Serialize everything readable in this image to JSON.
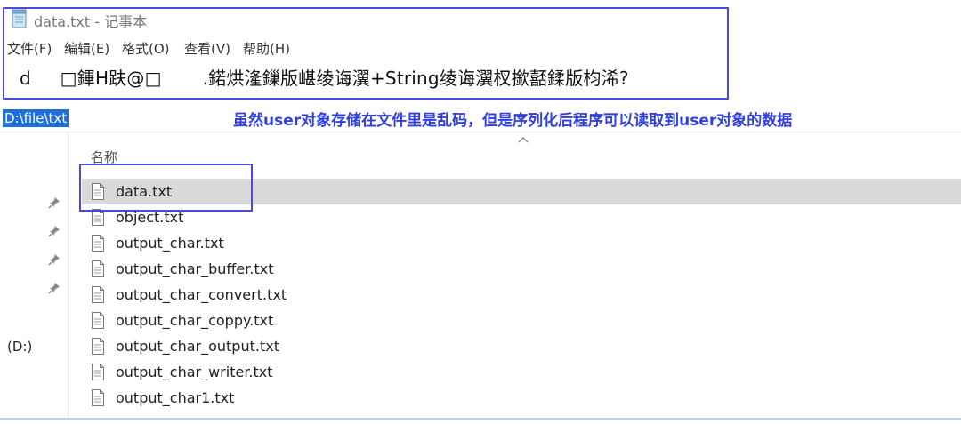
{
  "notepad": {
    "title": "data.txt - 记事本",
    "menu": [
      "文件(F)",
      "编辑(E)",
      "格式(O)",
      "查看(V)",
      "帮助(H)"
    ],
    "content": "d     □鏎H趺@□       .鍩烘湰鏁版嵁绫诲瀷+String绫诲瀷杈撳嚭鍒版枃浠?"
  },
  "explorer": {
    "address_path": "D:\\file\\txt",
    "annotation": "虽然user对象存储在文件里是乱码，但是序列化后程序可以读取到user对象的数据",
    "column_name": "名称",
    "drive_label": "(D:)",
    "files": [
      {
        "name": "data.txt",
        "selected": true
      },
      {
        "name": "object.txt",
        "selected": false
      },
      {
        "name": "output_char.txt",
        "selected": false
      },
      {
        "name": "output_char_buffer.txt",
        "selected": false
      },
      {
        "name": "output_char_convert.txt",
        "selected": false
      },
      {
        "name": "output_char_coppy.txt",
        "selected": false
      },
      {
        "name": "output_char_output.txt",
        "selected": false
      },
      {
        "name": "output_char_writer.txt",
        "selected": false
      },
      {
        "name": "output_char1.txt",
        "selected": false
      }
    ],
    "pinned_count": 4
  },
  "colors": {
    "highlight_box": "#4a4ad6",
    "annotation_text": "#2f3fe0",
    "selected_row": "#d9d9d9",
    "address_selection": "#1e6fd9"
  }
}
